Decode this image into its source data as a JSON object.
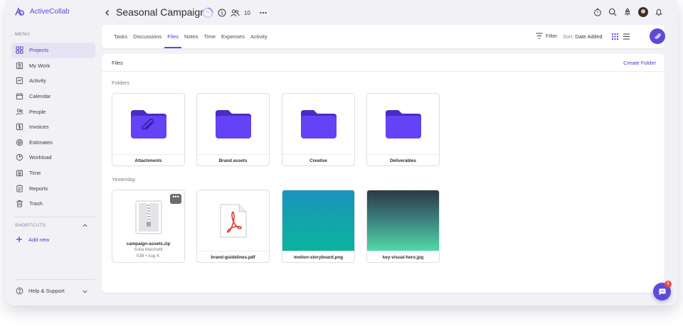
{
  "app": {
    "name": "ActiveCollab"
  },
  "sidebar": {
    "menu_label": "MENU",
    "items": [
      {
        "label": "Projects",
        "icon": "grid-icon",
        "active": true
      },
      {
        "label": "My Work",
        "icon": "mywork-icon"
      },
      {
        "label": "Activity",
        "icon": "activity-icon"
      },
      {
        "label": "Calendar",
        "icon": "calendar-icon"
      },
      {
        "label": "People",
        "icon": "people-icon"
      },
      {
        "label": "Invoices",
        "icon": "invoice-icon"
      },
      {
        "label": "Estimates",
        "icon": "estimate-icon"
      },
      {
        "label": "Workload",
        "icon": "workload-icon"
      },
      {
        "label": "Time",
        "icon": "time-icon"
      },
      {
        "label": "Reports",
        "icon": "reports-icon"
      },
      {
        "label": "Trash",
        "icon": "trash-icon"
      }
    ],
    "shortcuts_label": "SHORTCUTS",
    "add_new": "Add new",
    "help": "Help & Support"
  },
  "header": {
    "title": "Seasonal Campaign",
    "members_count": "10"
  },
  "tabs": {
    "items": [
      "Tasks",
      "Discussions",
      "Files",
      "Notes",
      "Time",
      "Expenses",
      "Activity"
    ],
    "active": "Files"
  },
  "toolbar": {
    "filter_label": "Filter",
    "sort_prefix": "Sort:",
    "sort_value": "Date Added"
  },
  "files": {
    "title": "Files",
    "create_folder": "Create Folder",
    "folders_label": "Folders",
    "folders": [
      {
        "name": "Attachments",
        "icon": "paperclip-icon"
      },
      {
        "name": "Brand assets"
      },
      {
        "name": "Creative"
      },
      {
        "name": "Deliverables"
      }
    ],
    "yesterday_label": "Yesterday",
    "items": [
      {
        "name": "campaign-assets.zip",
        "author": "Sofia Marchetti",
        "meta": "53B • Aug 4."
      },
      {
        "name": "brand-guidelines.pdf"
      },
      {
        "name": "motion-storyboard.png"
      },
      {
        "name": "key-visual-hero.jpg"
      }
    ]
  },
  "chat": {
    "badge": "5"
  },
  "colors": {
    "accent": "#5b4bd6",
    "folder": "#6442f5",
    "folder_tab": "#4a2cc4"
  }
}
